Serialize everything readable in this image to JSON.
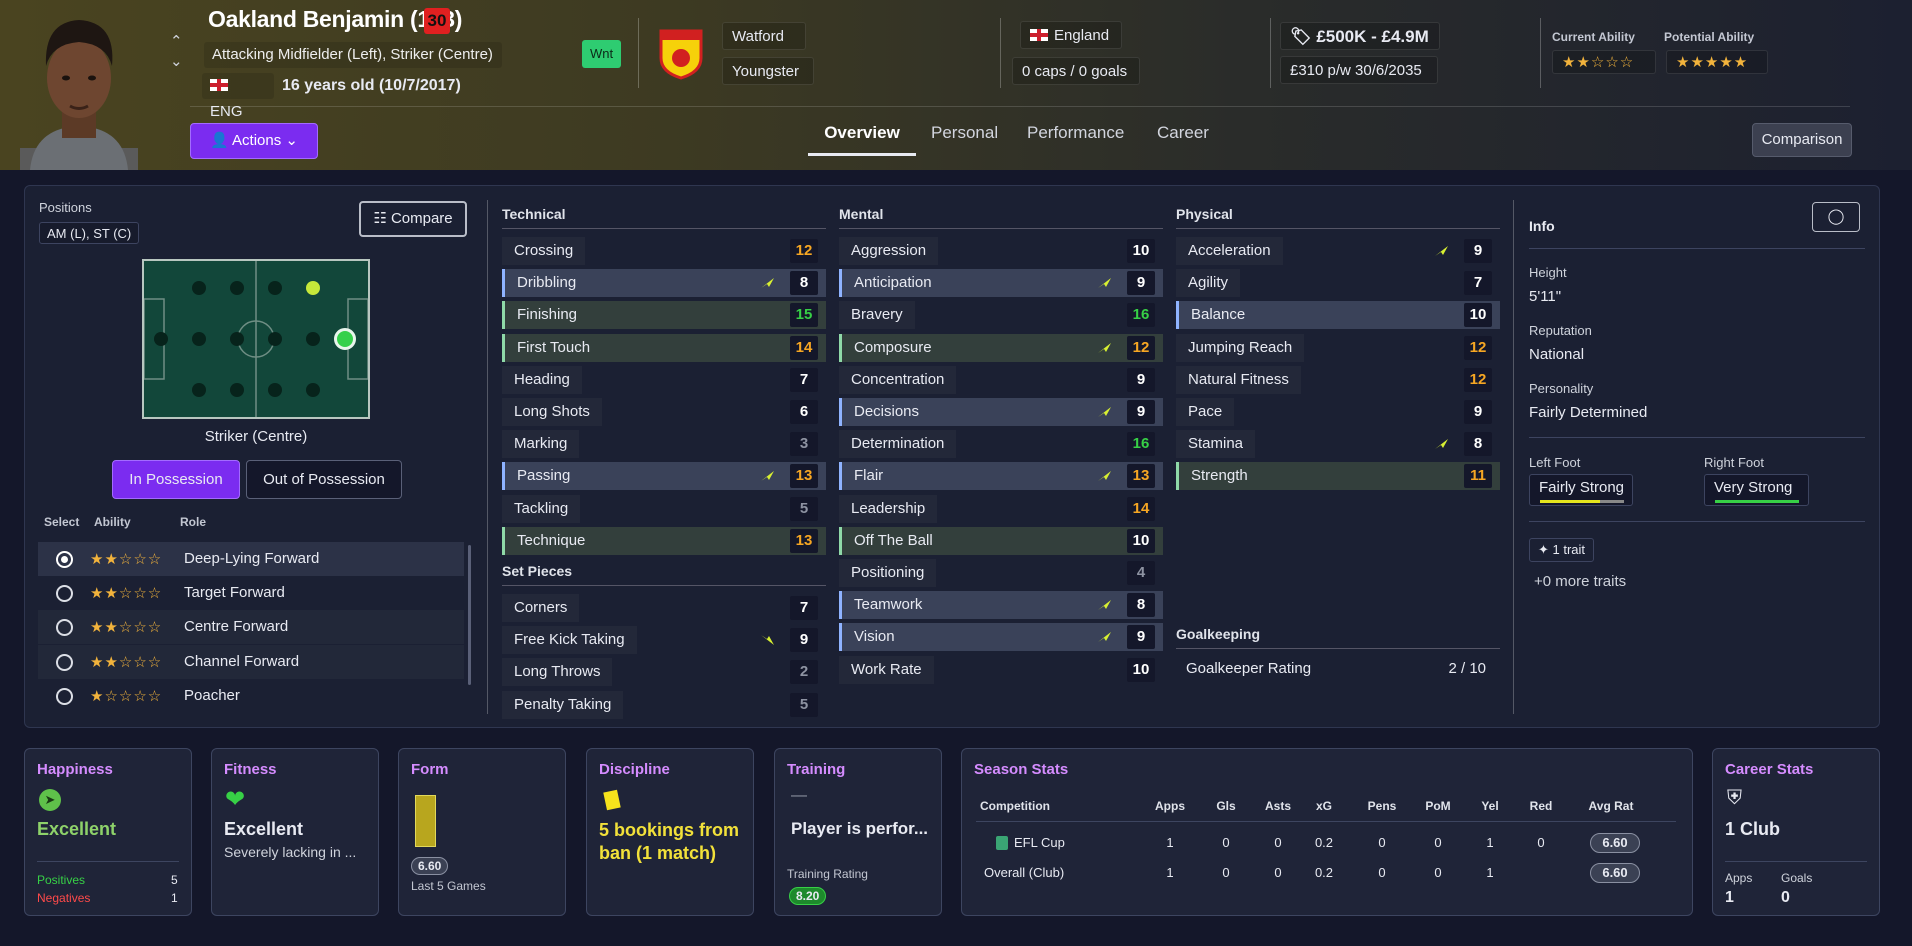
{
  "header": {
    "name": "Oakland Benjamin (133)",
    "age_badge": "30",
    "positions": "Attacking Midfielder (Left), Striker (Centre)",
    "nationality_code": "ENG",
    "age_line": "16 years old (10/7/2017)",
    "wnt": "Wnt",
    "club": "Watford",
    "squad_status": "Youngster",
    "country": "England",
    "caps": "0 caps / 0 goals",
    "value": "£500K - £4.9M",
    "wage": "£310 p/w 30/6/2035",
    "current_ability_label": "Current Ability",
    "current_ability_stars": "★★☆☆☆",
    "potential_ability_label": "Potential Ability",
    "potential_ability_stars": "★★★★★",
    "actions": "Actions",
    "comparison": "Comparison"
  },
  "tabs": [
    "Overview",
    "Personal",
    "Performance",
    "Career"
  ],
  "positions_panel": {
    "label": "Positions",
    "chip": "AM (L), ST (C)",
    "compare": "Compare",
    "pitch_position": "Striker (Centre)",
    "in_possession": "In Possession",
    "out_possession": "Out of Possession",
    "col_select": "Select",
    "col_ability": "Ability",
    "col_role": "Role",
    "roles": [
      {
        "stars": "★★☆☆☆",
        "name": "Deep-Lying Forward"
      },
      {
        "stars": "★★☆☆☆",
        "name": "Target Forward"
      },
      {
        "stars": "★★☆☆☆",
        "name": "Centre Forward"
      },
      {
        "stars": "★★☆☆☆",
        "name": "Channel Forward"
      },
      {
        "stars": "★☆☆☆☆",
        "name": "Poacher"
      }
    ]
  },
  "technical": {
    "title": "Technical",
    "attrs": [
      {
        "n": "Crossing",
        "v": "12"
      },
      {
        "n": "Dribbling",
        "v": "8"
      },
      {
        "n": "Finishing",
        "v": "15"
      },
      {
        "n": "First Touch",
        "v": "14"
      },
      {
        "n": "Heading",
        "v": "7"
      },
      {
        "n": "Long Shots",
        "v": "6"
      },
      {
        "n": "Marking",
        "v": "3"
      },
      {
        "n": "Passing",
        "v": "13"
      },
      {
        "n": "Tackling",
        "v": "5"
      },
      {
        "n": "Technique",
        "v": "13"
      }
    ]
  },
  "set_pieces": {
    "title": "Set Pieces",
    "attrs": [
      {
        "n": "Corners",
        "v": "7"
      },
      {
        "n": "Free Kick Taking",
        "v": "9"
      },
      {
        "n": "Long Throws",
        "v": "2"
      },
      {
        "n": "Penalty Taking",
        "v": "5"
      }
    ]
  },
  "mental": {
    "title": "Mental",
    "attrs": [
      {
        "n": "Aggression",
        "v": "10"
      },
      {
        "n": "Anticipation",
        "v": "9"
      },
      {
        "n": "Bravery",
        "v": "16"
      },
      {
        "n": "Composure",
        "v": "12"
      },
      {
        "n": "Concentration",
        "v": "9"
      },
      {
        "n": "Decisions",
        "v": "9"
      },
      {
        "n": "Determination",
        "v": "16"
      },
      {
        "n": "Flair",
        "v": "13"
      },
      {
        "n": "Leadership",
        "v": "14"
      },
      {
        "n": "Off The Ball",
        "v": "10"
      },
      {
        "n": "Positioning",
        "v": "4"
      },
      {
        "n": "Teamwork",
        "v": "8"
      },
      {
        "n": "Vision",
        "v": "9"
      },
      {
        "n": "Work Rate",
        "v": "10"
      }
    ]
  },
  "physical": {
    "title": "Physical",
    "attrs": [
      {
        "n": "Acceleration",
        "v": "9"
      },
      {
        "n": "Agility",
        "v": "7"
      },
      {
        "n": "Balance",
        "v": "10"
      },
      {
        "n": "Jumping Reach",
        "v": "12"
      },
      {
        "n": "Natural Fitness",
        "v": "12"
      },
      {
        "n": "Pace",
        "v": "9"
      },
      {
        "n": "Stamina",
        "v": "8"
      },
      {
        "n": "Strength",
        "v": "11"
      }
    ]
  },
  "goalkeeping": {
    "title": "Goalkeeping",
    "label": "Goalkeeper Rating",
    "value": "2 / 10"
  },
  "info": {
    "title": "Info",
    "height_label": "Height",
    "height": "5'11\"",
    "rep_label": "Reputation",
    "rep": "National",
    "pers_label": "Personality",
    "pers": "Fairly Determined",
    "left_foot_label": "Left Foot",
    "left_foot": "Fairly Strong",
    "right_foot_label": "Right Foot",
    "right_foot": "Very Strong",
    "trait": "1 trait",
    "more_traits": "+0 more traits"
  },
  "cards": {
    "happiness": {
      "title": "Happiness",
      "value": "Excellent",
      "pos_label": "Positives",
      "pos": "5",
      "neg_label": "Negatives",
      "neg": "1"
    },
    "fitness": {
      "title": "Fitness",
      "value": "Excellent",
      "sub": "Severely lacking in ..."
    },
    "form": {
      "title": "Form",
      "rating": "6.60",
      "sub": "Last 5 Games"
    },
    "discipline": {
      "title": "Discipline",
      "value": "5 bookings from ban (1 match)"
    },
    "training": {
      "title": "Training",
      "dash": "—",
      "value": "Player is perfor...",
      "rating_label": "Training Rating",
      "rating": "8.20"
    },
    "season": {
      "title": "Season Stats",
      "headers": [
        "Competition",
        "Apps",
        "Gls",
        "Asts",
        "xG",
        "Pens",
        "PoM",
        "Yel",
        "Red",
        "Avg Rat"
      ],
      "rows": [
        [
          "EFL Cup",
          "1",
          "0",
          "0",
          "0.2",
          "0",
          "0",
          "1",
          "0",
          "6.60"
        ],
        [
          "Overall (Club)",
          "1",
          "0",
          "0",
          "0.2",
          "0",
          "0",
          "1",
          "",
          "6.60"
        ]
      ]
    },
    "career": {
      "title": "Career Stats",
      "value": "1 Club",
      "apps_label": "Apps",
      "apps": "1",
      "goals_label": "Goals",
      "goals": "0"
    }
  },
  "colors": {
    "accent": "#7b2cf0",
    "orange": "#f6a623",
    "green": "#37d046",
    "card_title": "#d58cff"
  }
}
